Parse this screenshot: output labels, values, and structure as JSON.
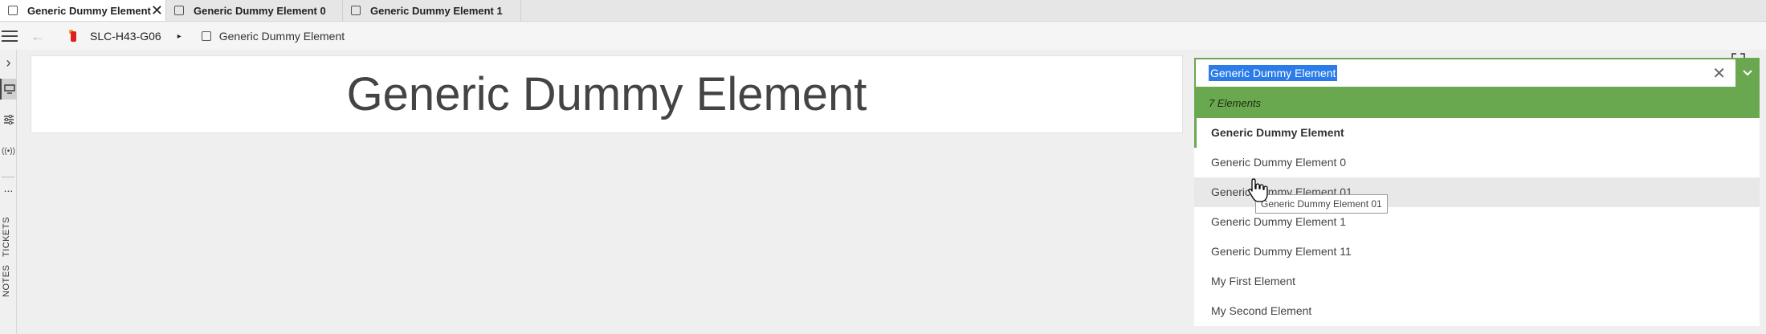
{
  "tabs": [
    {
      "label": "Generic Dummy Element",
      "active": true,
      "close": "✕"
    },
    {
      "label": "Generic Dummy Element 0"
    },
    {
      "label": "Generic Dummy Element 1"
    }
  ],
  "toolbar": {
    "back_icon": "arrow-left-icon",
    "crumb_root": "SLC-H43-G06",
    "crumb_arrow": "▸",
    "crumb_current": "Generic Dummy Element"
  },
  "rail": {
    "expand": "›",
    "tickets": "TICKETS",
    "notes": "NOTES",
    "more": "..."
  },
  "main": {
    "title": "Generic Dummy Element"
  },
  "dropdown": {
    "value": "Generic Dummy Element",
    "clear": "✕",
    "count_label": "7 Elements",
    "items": [
      "Generic Dummy Element",
      "Generic Dummy Element 0",
      "Generic Dummy Element 01",
      "Generic Dummy Element 1",
      "Generic Dummy Element 11",
      "My First Element",
      "My Second Element"
    ],
    "current_index": 0,
    "hover_index": 2
  },
  "tooltip": "Generic Dummy Element 01",
  "colors": {
    "accent": "#6aa84f",
    "selection": "#2b7ce9"
  }
}
